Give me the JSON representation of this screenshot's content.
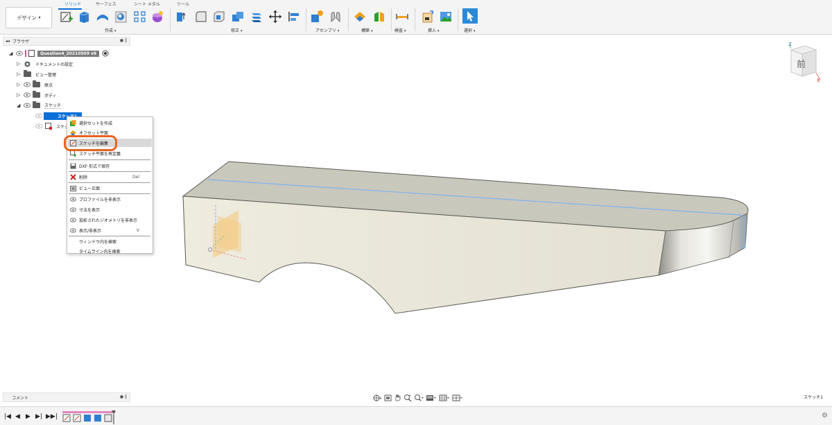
{
  "toolbar": {
    "workspace_label": "デザイン",
    "workspace_caret": "▾",
    "tabs": [
      "ソリッド",
      "サーフェス",
      "シート メタル",
      "ツール"
    ],
    "groups": [
      "作成",
      "修正",
      "アセンブリ",
      "構築",
      "検査",
      "挿入",
      "選択"
    ],
    "caret": "▾"
  },
  "browser": {
    "collapse_glyph": "◂◂",
    "title": "ブラウザ",
    "header_buttons": "● ‖",
    "root": "Question4_20210509 v6",
    "items": [
      "ドキュメントの設定",
      "ビュー管理",
      "原点",
      "ボディ",
      "スケッチ"
    ],
    "sketch_children": [
      "スケッチ1",
      "スケッ"
    ]
  },
  "context_menu": {
    "items": [
      "選択セットを作成",
      "オフセット平面",
      "スケッチを編集",
      "スケッチ平面を再定義",
      "DXF 形式で保存",
      "削除",
      "ビュー正面",
      "プロファイルを非表示",
      "寸法を表示",
      "投影されたジオメトリを非表示",
      "表示/非表示",
      "ウィンドウ内を検索",
      "タイムライン内を検索"
    ],
    "shortcuts": {
      "delete": "Del",
      "toggle": "V"
    }
  },
  "viewcube": {
    "face": "前",
    "axis_z": "Z",
    "axis_x": "X"
  },
  "comments": {
    "label": "コメント",
    "buttons": "● ‖"
  },
  "navbar": {
    "icons": [
      "orbit-icon",
      "look-at-icon",
      "pan-icon",
      "zoom-window-icon",
      "zoom-icon",
      "display-settings-icon",
      "grid-icon",
      "viewports-icon"
    ]
  },
  "status": {
    "active_sketch": "スケッチ1"
  },
  "timeline": {
    "controls": [
      "|◀",
      "◀",
      "▶",
      "▶|",
      "▶▶|"
    ]
  },
  "colors": {
    "accent": "#0a6fd8",
    "highlight_ring": "#e8631d",
    "body_side": "#ebe8dc",
    "body_top": "#c9c8bd"
  }
}
